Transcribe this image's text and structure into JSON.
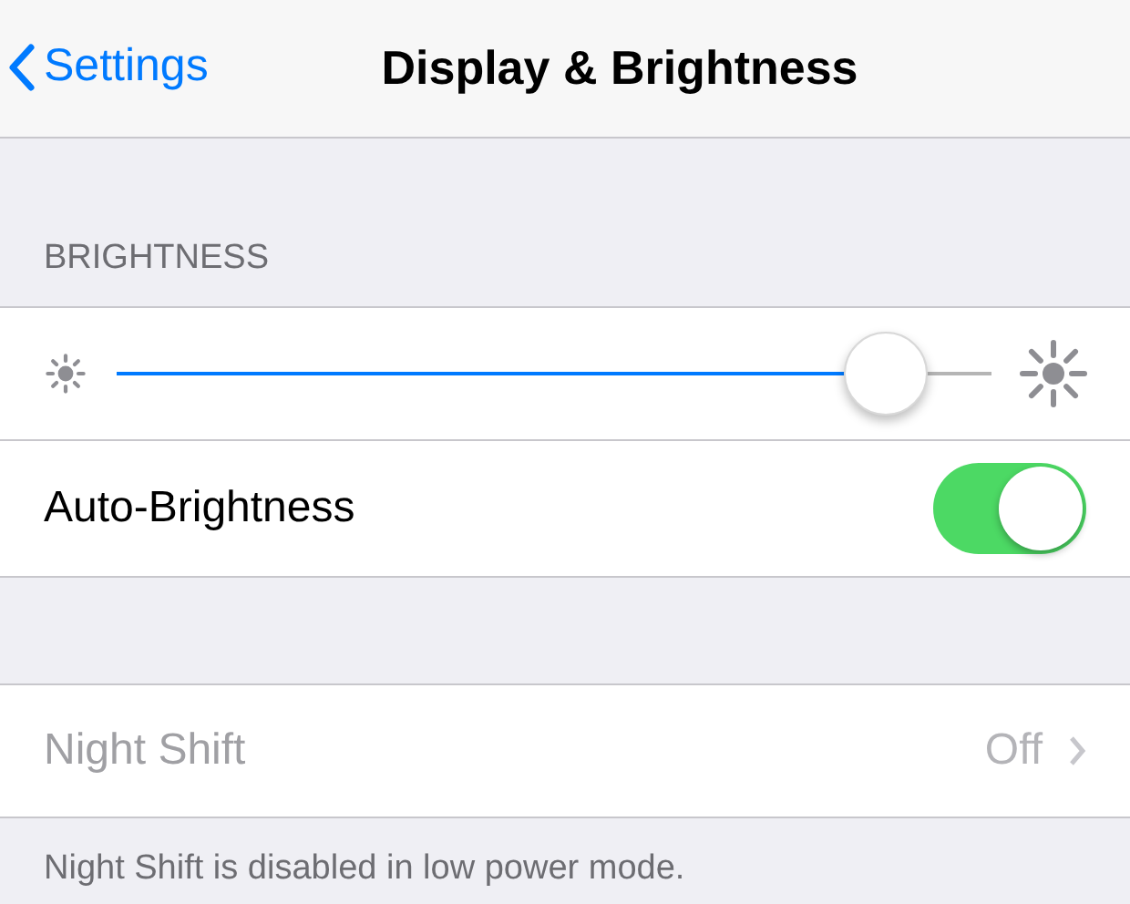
{
  "nav": {
    "back_label": "Settings",
    "title": "Display & Brightness"
  },
  "brightness_section": {
    "header": "BRIGHTNESS",
    "slider": {
      "level": 0.88
    },
    "auto_brightness": {
      "label": "Auto-Brightness",
      "on": true
    }
  },
  "night_shift": {
    "label": "Night Shift",
    "value": "Off",
    "disabled": true
  },
  "footer": "Night Shift is disabled in low power mode."
}
